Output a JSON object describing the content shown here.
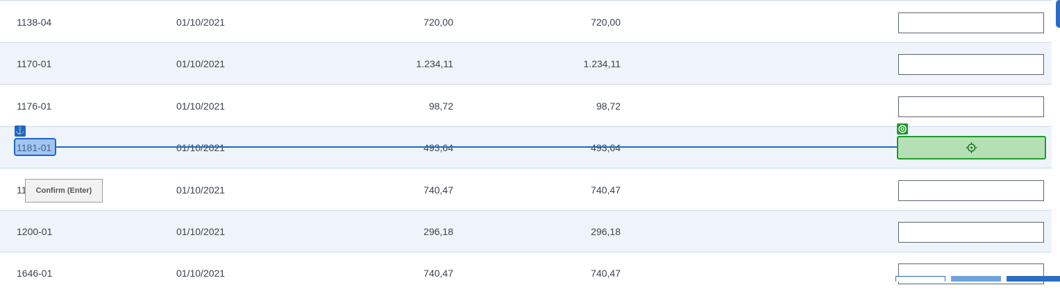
{
  "rows": [
    {
      "code": "1138-04",
      "date": "01/10/2021",
      "value1": "720,00",
      "value2": "720,00"
    },
    {
      "code": "1170-01",
      "date": "01/10/2021",
      "value1": "1.234,11",
      "value2": "1.234,11"
    },
    {
      "code": "1176-01",
      "date": "01/10/2021",
      "value1": "98,72",
      "value2": "98,72"
    },
    {
      "code": "1181-01",
      "date": "01/10/2021",
      "value1": "493,64",
      "value2": "493,64"
    },
    {
      "code": "1186-01",
      "date": "01/10/2021",
      "value1": "740,47",
      "value2": "740,47"
    },
    {
      "code": "1200-01",
      "date": "01/10/2021",
      "value1": "296,18",
      "value2": "296,18"
    },
    {
      "code": "1646-01",
      "date": "01/10/2021",
      "value1": "740,47",
      "value2": "740,47"
    }
  ],
  "tooltip": {
    "text": "Confirm (Enter)"
  },
  "overlay": {
    "anchor_icon": "anchor-icon",
    "target_icon": "target-icon",
    "colors": {
      "anchor": "#1f64c8",
      "target": "#1d9a2a"
    }
  }
}
